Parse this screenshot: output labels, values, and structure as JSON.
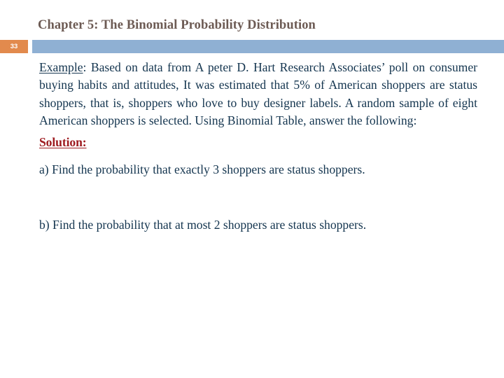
{
  "slide": {
    "title": "Chapter 5: The Binomial Probability Distribution",
    "number": "33",
    "colors": {
      "title_text": "#6d5b54",
      "badge_background": "#e28a4d",
      "badge_text": "#ffffff",
      "header_band": "#8fb0d3",
      "body_text": "#14354f",
      "solution_text": "#9e1b20",
      "background": "#ffffff"
    }
  },
  "body": {
    "example_label": "Example",
    "example_separator": ":",
    "example_text": " Based on data from A peter D. Hart Research Associates’ poll on consumer buying habits and attitudes, It was estimated that 5% of American shoppers are status shoppers, that is, shoppers who love to buy designer labels. A random sample of eight American shoppers is selected. Using Binomial Table, answer the following:",
    "solution_label": "Solution:",
    "question_a": "a) Find the probability that exactly 3 shoppers are status shoppers.",
    "question_b": "b) Find the probability that at most 2 shoppers are status shoppers."
  }
}
